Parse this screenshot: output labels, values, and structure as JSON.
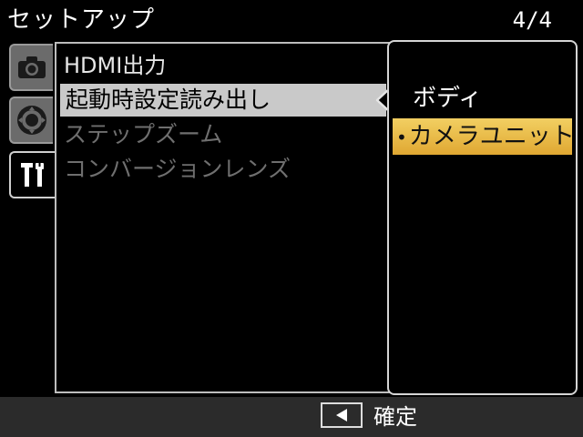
{
  "header": {
    "title": "セットアップ",
    "page": "4/4"
  },
  "tabs": [
    {
      "icon": "camera-icon",
      "active": false
    },
    {
      "icon": "playback-dial-icon",
      "active": false
    },
    {
      "icon": "wrench-screwdriver-icon",
      "active": true
    }
  ],
  "menu": {
    "items": [
      {
        "label": "HDMI出力",
        "state": "enabled"
      },
      {
        "label": "起動時設定読み出し",
        "state": "selected"
      },
      {
        "label": "ステップズーム",
        "state": "disabled"
      },
      {
        "label": "コンバージョンレンズ",
        "state": "disabled"
      }
    ]
  },
  "submenu": {
    "options": [
      {
        "label": "ボディ",
        "selected": false
      },
      {
        "label": "カメラユニット",
        "selected": true
      }
    ],
    "bullet": "•"
  },
  "footer": {
    "key_icon": "left-arrow-key-icon",
    "label": "確定"
  },
  "colors": {
    "highlight": "#c9c9c9",
    "selected_option": "#e8b84a",
    "footer_bg": "#2b2b2b"
  }
}
